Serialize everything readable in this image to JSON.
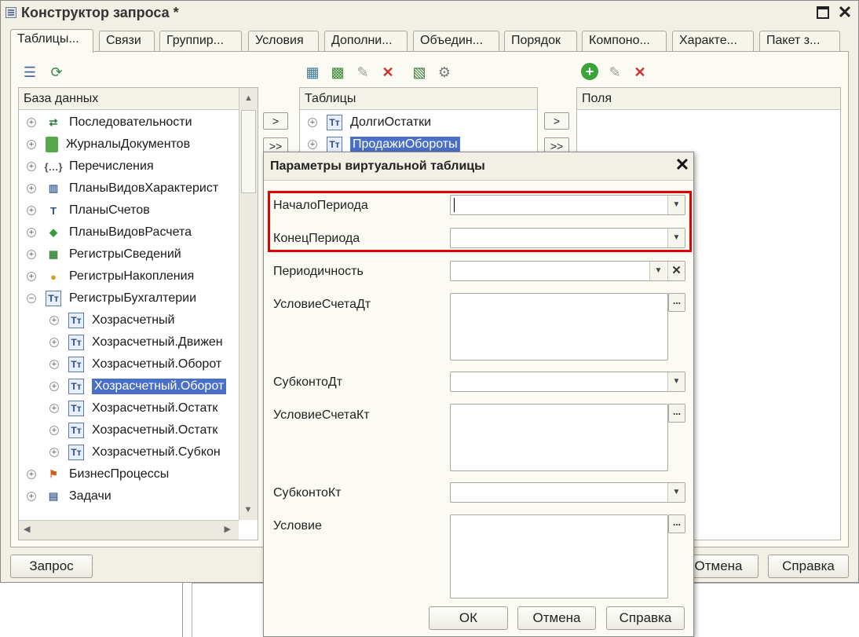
{
  "window": {
    "title": "Конструктор запроса *"
  },
  "tabs": [
    {
      "label": "Таблицы..."
    },
    {
      "label": "Связи"
    },
    {
      "label": "Группир..."
    },
    {
      "label": "Условия"
    },
    {
      "label": "Дополни..."
    },
    {
      "label": "Объедин..."
    },
    {
      "label": "Порядок"
    },
    {
      "label": "Компоно..."
    },
    {
      "label": "Характе..."
    },
    {
      "label": "Пакет з..."
    }
  ],
  "database_panel": {
    "header": "База данных",
    "items": [
      {
        "label": "Последовательности",
        "icon": "sequence-icon"
      },
      {
        "label": "ЖурналыДокументов",
        "icon": "journal-icon"
      },
      {
        "label": "Перечисления",
        "icon": "enum-icon"
      },
      {
        "label": "ПланыВидовХарактерист",
        "icon": "chart-of-characteristics-icon"
      },
      {
        "label": "ПланыСчетов",
        "icon": "chart-of-accounts-icon"
      },
      {
        "label": "ПланыВидовРасчета",
        "icon": "calculation-types-icon"
      },
      {
        "label": "РегистрыСведений",
        "icon": "info-register-icon"
      },
      {
        "label": "РегистрыНакопления",
        "icon": "accumulation-register-icon"
      },
      {
        "label": "РегистрыБухгалтерии",
        "icon": "accounting-register-icon"
      },
      {
        "label": "Хозрасчетный",
        "icon": "table-icon"
      },
      {
        "label": "Хозрасчетный.Движен",
        "icon": "table-icon"
      },
      {
        "label": "Хозрасчетный.Оборот",
        "icon": "table-icon"
      },
      {
        "label": "Хозрасчетный.Оборот",
        "icon": "table-icon"
      },
      {
        "label": "Хозрасчетный.Остатк",
        "icon": "table-icon"
      },
      {
        "label": "Хозрасчетный.Остатк",
        "icon": "table-icon"
      },
      {
        "label": "Хозрасчетный.Субкон",
        "icon": "table-icon"
      },
      {
        "label": "БизнесПроцессы",
        "icon": "business-process-icon"
      },
      {
        "label": "Задачи",
        "icon": "task-icon"
      }
    ]
  },
  "tables_panel": {
    "header": "Таблицы",
    "items": [
      {
        "label": "ДолгиОстатки"
      },
      {
        "label": "ПродажиОбороты"
      }
    ]
  },
  "fields_panel": {
    "header": "Поля"
  },
  "move_buttons": {
    "single": ">",
    "all": ">>"
  },
  "bottom_buttons": {
    "query": "Запрос",
    "cancel": "Отмена",
    "help": "Справка"
  },
  "dialog": {
    "title": "Параметры виртуальной таблицы",
    "params": {
      "period_start": "НачалоПериода",
      "period_end": "КонецПериода",
      "periodicity": "Периодичность",
      "account_dt_condition": "УсловиеСчетаДт",
      "subconto_dt": "СубконтоДт",
      "account_kt_condition": "УсловиеСчетаКт",
      "subconto_kt": "СубконтоКт",
      "condition": "Условие"
    },
    "ellipsis": "...",
    "ok": "ОК",
    "cancel": "Отмена",
    "help": "Справка"
  },
  "colors": {
    "selection": "#4a6fc8",
    "highlight_frame": "#e00000",
    "window_bg": "#f2f0e4"
  }
}
